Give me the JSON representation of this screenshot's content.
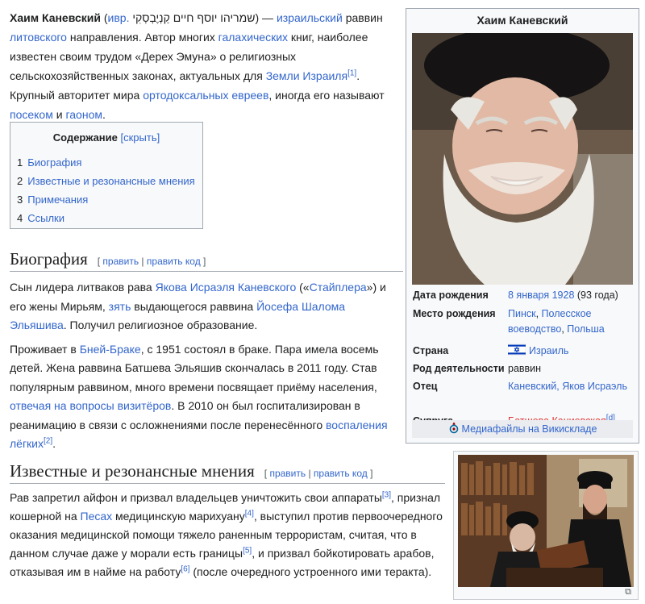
{
  "lead": {
    "name_bold": "Хаим Каневский",
    "lang_open": " (",
    "lang_link": "ивр.",
    "hebrew": " שמריהו יוסף חיים קַנְיֶבְסְקִי",
    "after_hebrew": ") — ",
    "link_israeli": "израильский",
    "t_rabbi": " раввин ",
    "link_lit": "литовского",
    "t_dir": " направления. Автор многих ",
    "link_halachic": "галахических",
    "t_books": " книг, наиболее известен своим трудом «Дерех Эмуна» о религиозных сельскохозяйственных законах, актуальных для ",
    "link_land": "Земли Израиля",
    "ref1": "[1]",
    "t_auth": ". Крупный авторитет мира ",
    "link_orth": "ортодоксальных евреев",
    "t_call": ", иногда его называют ",
    "link_posek": "посеком",
    "t_and": " и ",
    "link_gaon": "гаоном",
    "t_end": "."
  },
  "toc": {
    "title": "Содержание",
    "hide": "[скрыть]",
    "items": [
      {
        "num": "1",
        "label": "Биография"
      },
      {
        "num": "2",
        "label": "Известные и резонансные мнения"
      },
      {
        "num": "3",
        "label": "Примечания"
      },
      {
        "num": "4",
        "label": "Ссылки"
      }
    ]
  },
  "edit": {
    "open": "[ ",
    "edit": "править",
    "sep": " | ",
    "edit_code": "править код",
    "close": " ]"
  },
  "sec1": {
    "heading": "Биография",
    "p1_a": "Сын лидера литваков рава ",
    "p1_link1": "Якова Исраэля Каневского",
    "p1_b": " («",
    "p1_link2": "Стайплера",
    "p1_c": "») и его жены Мирьям, ",
    "p1_link3": "зять",
    "p1_d": " выдающегося раввина ",
    "p1_link4": "Йосефа Шалома Эльяшива",
    "p1_e": ". Получил религиозное образование.",
    "p2_a": "Проживает в ",
    "p2_link1": "Бней-Браке",
    "p2_b": ", с 1951 состоял в браке. Пара имела восемь детей. Жена раввина Батшева Эльяшив скончалась в 2011 году. Став популярным раввином, много времени посвящает приёму населения, ",
    "p2_link2": "отвечая на вопросы визитёров",
    "p2_c": ". В 2010 он был госпитализирован в реанимацию в связи с осложнениями после перенесённого ",
    "p2_link3": "воспаления лёгких",
    "ref2": "[2]",
    "p2_d": "."
  },
  "sec2": {
    "heading": "Известные и резонансные мнения",
    "a": "Рав запретил айфон и призвал владельцев уничтожить свои аппараты",
    "ref3": "[3]",
    "b": ", признал кошерной на ",
    "link_pesach": "Песах",
    "c": " медицинскую марихуану",
    "ref4": "[4]",
    "d": ", выступил против первоочередного оказания медицинской помощи тяжело раненным террористам, считая, что в данном случае даже у морали есть границы",
    "ref5": "[5]",
    "e": ", и призвал бойкотировать арабов, отказывая им в найме на работу",
    "ref6": "[6]",
    "f": " (после очередного устроенного ими теракта)."
  },
  "infobox": {
    "title": "Хаим Каневский",
    "birth_date_label": "Дата рождения",
    "birth_date_link": "8 января 1928",
    "birth_date_age": " (93 года)",
    "birth_place_label": "Место рождения",
    "birth_place_link1": "Пинск",
    "birth_place_sep1": ", ",
    "birth_place_link2": "Полесское воеводство",
    "birth_place_sep2": ", ",
    "birth_place_link3": "Польша",
    "country_label": "Страна",
    "country_link": "Израиль",
    "occupation_label": "Род деятельности",
    "occupation_value": "раввин",
    "father_label": "Отец",
    "father_link": "Каневский, Яков Исраэль",
    "spouse_label": "Супруга",
    "spouse_link": "Батшева Каниевская",
    "spouse_ref": "[d]",
    "media": "Медиафайлы на Викискладе"
  },
  "colors": {
    "link": "#3366cc",
    "redlink": "#d33",
    "border": "#a2a9b1",
    "box_bg": "#f8f9fa"
  }
}
